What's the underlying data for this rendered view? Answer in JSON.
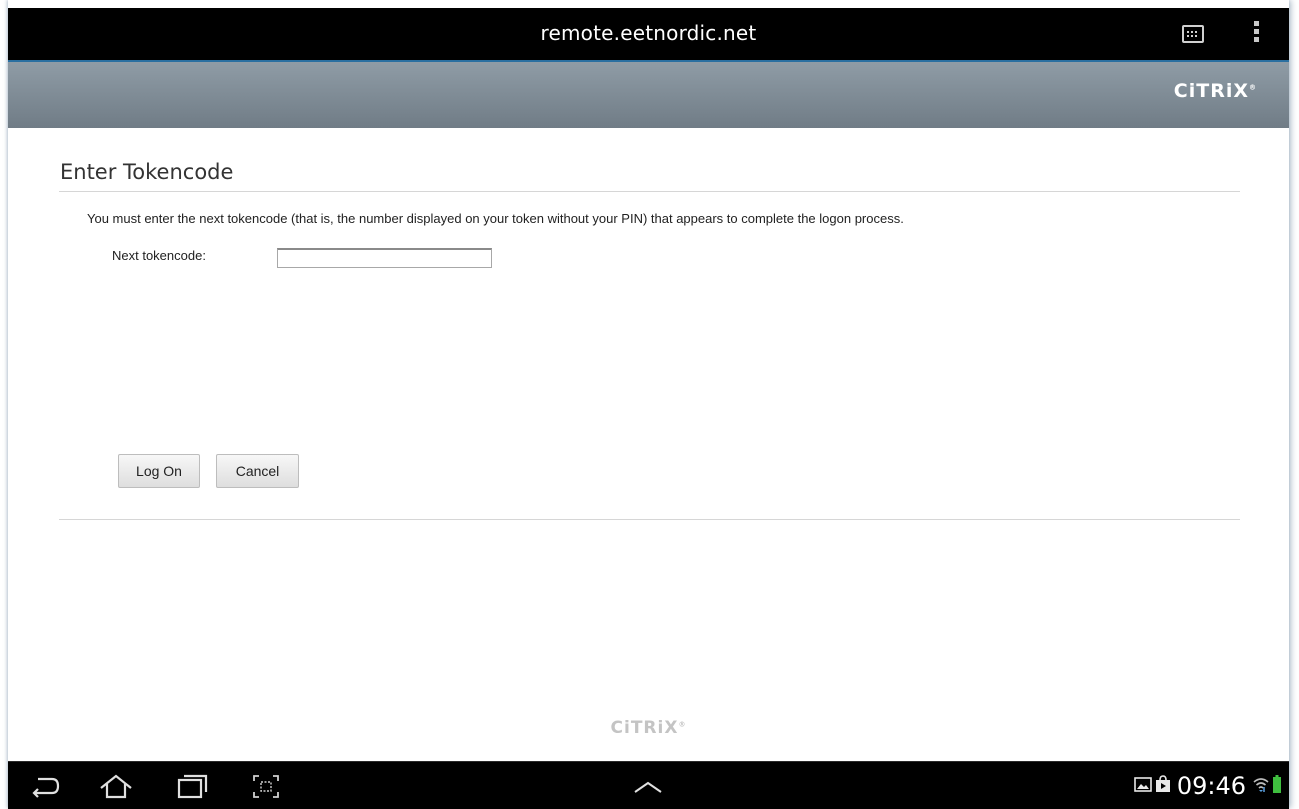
{
  "browser": {
    "url": "remote.eetnordic.net"
  },
  "banner": {
    "logo_text": "CiTRiX",
    "logo_mark": "®"
  },
  "form": {
    "title": "Enter Tokencode",
    "instructions": "You must enter the next tokencode (that is, the number displayed on your token without your PIN) that appears to complete the logon process.",
    "tokencode_label": "Next tokencode:",
    "tokencode_value": "",
    "logon_label": "Log On",
    "cancel_label": "Cancel"
  },
  "footer": {
    "logo_text": "CiTRiX",
    "logo_mark": "®"
  },
  "system_bar": {
    "time": "09:46",
    "icons": [
      "back-icon",
      "home-icon",
      "recent-apps-icon",
      "screenshot-icon",
      "chevron-up-icon",
      "gallery-notification-icon",
      "store-notification-icon",
      "wifi-icon",
      "battery-icon"
    ]
  },
  "colors": {
    "top_bar": "#000000",
    "banner": "#7f8b95",
    "banner_accent": "#2a6fa0",
    "page": "#ffffff",
    "battery": "#3fbf3f"
  }
}
